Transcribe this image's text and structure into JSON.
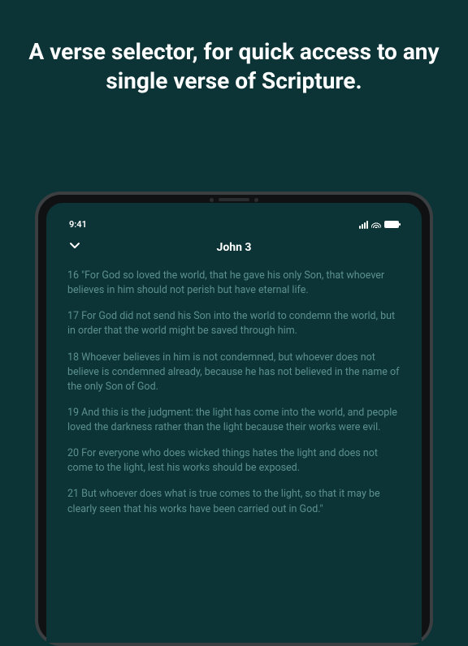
{
  "headline": "A verse selector, for quick access to any single verse of Scripture.",
  "status": {
    "time": "9:41"
  },
  "nav": {
    "title": "John 3"
  },
  "verses": [
    {
      "n": 16,
      "text": "16 \"For  God so loved  the world,   that he gave his only Son, that whoever believes in him should not  perish but have eternal life."
    },
    {
      "n": 17,
      "text": "17 For God did not send his Son into the world to condemn the world, but in order that the world might be saved through him."
    },
    {
      "n": 18,
      "text": "18 Whoever believes in him is not condemned, but whoever does not believe is condemned already, because he has not believed in the name of the only Son of God."
    },
    {
      "n": 19,
      "text": "19 And this is the judgment: the light has come into the world, and people loved the darkness rather than the light because their works were evil."
    },
    {
      "n": 20,
      "text": "20 For everyone who does wicked things hates the light and does not come to the light, lest his works should be exposed."
    },
    {
      "n": 21,
      "text": "21 But whoever does what is true comes to the light, so that it may be clearly seen that his works have been carried out in God.\""
    }
  ],
  "colors": {
    "bg": "#0c3436",
    "verse": "#5c908f",
    "text": "#ffffff"
  }
}
